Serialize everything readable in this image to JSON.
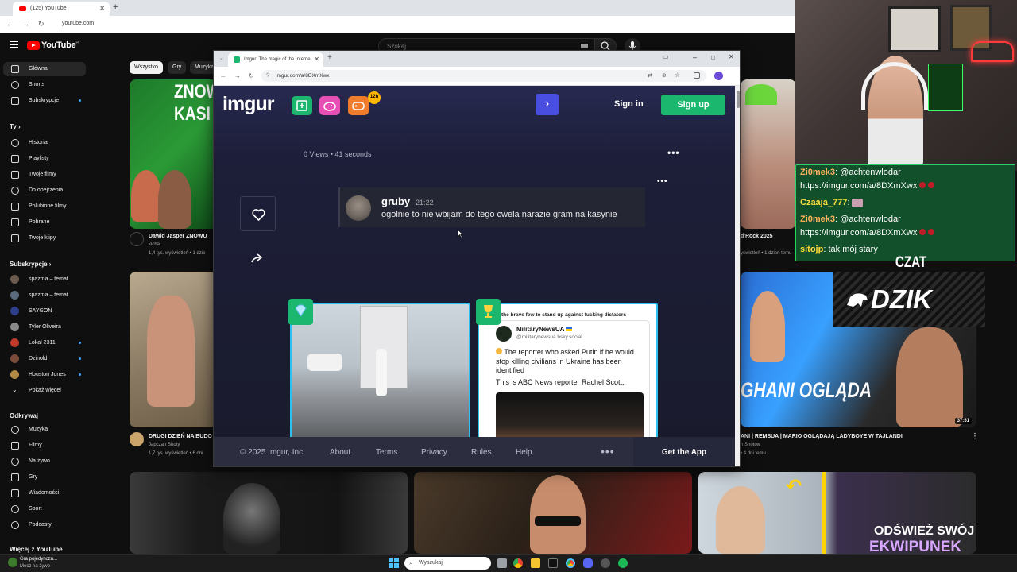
{
  "outer_browser": {
    "tab_title": "(125) YouTube",
    "url": "youtube.com"
  },
  "youtube": {
    "logo": "YouTube",
    "logo_region": "PL",
    "search_placeholder": "Szukaj",
    "chips": [
      "Wszystko",
      "Gry",
      "Muzyka"
    ],
    "sidebar": {
      "main": [
        "Główna",
        "Shorts",
        "Subskrypcje"
      ],
      "you_header": "Ty",
      "you": [
        "Historia",
        "Playlisty",
        "Twoje filmy",
        "Do obejrzenia",
        "Polubione filmy",
        "Pobrane",
        "Twoje klipy"
      ],
      "subs_header": "Subskrypcje",
      "subs": [
        "spazma – temat",
        "spazma – temat",
        "SAYGON",
        "Tyler Oliveira",
        "Lokal 2311",
        "Dzinold",
        "Houston Jones"
      ],
      "show_more": "Pokaż więcej",
      "explore_header": "Odkrywaj",
      "explore": [
        "Muzyka",
        "Filmy",
        "Na żywo",
        "Gry",
        "Wiadomości",
        "Sport",
        "Podcasty"
      ],
      "more_header": "Więcej z YouTube"
    },
    "videos": {
      "v1_title": "Dawid Jasper ZNOWU",
      "v1_channel": "kichal",
      "v1_meta": "1,4 tys. wyświetleń • 1 dzie",
      "v1_thumb_text": "ZNOW KASI",
      "v2_title": "DRUGI DZIEŃ NA BUDO",
      "v2_channel": "Japczan Shoty",
      "v2_meta": "1,7 tys. wyświetleń • 6 dni",
      "v3_title": "d'Rock 2025",
      "v3_meta": "yświetleń • 1 dzień temu",
      "v4_title": "ANI | REMSUA | MARIO OGLĄDAJĄ LADYBOYE W TAJLANDI",
      "v4_channel": "n Shotów",
      "v4_meta": "• 4 dni temu",
      "v4_thumb_text": "GHANI OGLĄDA",
      "v4_duration": "37:51"
    }
  },
  "inner_browser": {
    "tab_title": "Imgur: The magic of the Interne",
    "url": "imgur.com/a/8DXmXwx"
  },
  "imgur": {
    "logo": "imgur",
    "badge": "12h",
    "sign_in": "Sign in",
    "sign_up": "Sign up",
    "views": "0 Views • 41 seconds",
    "comment": {
      "user": "gruby",
      "time": "21:22",
      "text": "ogolnie to nie wbijam do tego cwela narazie gram na kasynie"
    },
    "card2": {
      "header": "f the brave few to stand up against fucking dictators",
      "account": "MilitaryNewsUA",
      "handle": "@militarynewsua.bsky.social",
      "body": "The reporter who asked Putin if he would stop killing civilians in Ukraine has been identified",
      "body2": "This is ABC News reporter Rachel Scott."
    },
    "footer": {
      "copyright": "© 2025 Imgur, Inc",
      "links": [
        "About",
        "Terms",
        "Privacy",
        "Rules",
        "Help"
      ],
      "get_app": "Get the App"
    }
  },
  "stream": {
    "chat": [
      {
        "user": "Zi0mek3",
        "text": "@achtenwlodar"
      },
      {
        "user": "",
        "text": "https://imgur.com/a/8DXmXwx"
      },
      {
        "user": "Czaaja_777",
        "text": ""
      },
      {
        "user": "Zi0mek3",
        "text": "@achtenwlodar"
      },
      {
        "user": "",
        "text": "https://imgur.com/a/8DXmXwx"
      },
      {
        "user": "sitojp",
        "text": "tak mój stary"
      }
    ],
    "chat_label": "CZAT",
    "brand": "DZIK",
    "promo_line1": "ODŚWIEŻ SWÓJ",
    "promo_line2": "EKWIPUNEK"
  },
  "taskbar": {
    "game_title": "Gra pojedyncza...",
    "game_sub": "Mecz na żywo",
    "search_placeholder": "Wyszukaj"
  },
  "colors": {
    "imgur_green": "#1bb76e",
    "imgur_blue": "#4a4ee0",
    "yt_red": "#ff0000",
    "chat_green": "#2bd461"
  }
}
